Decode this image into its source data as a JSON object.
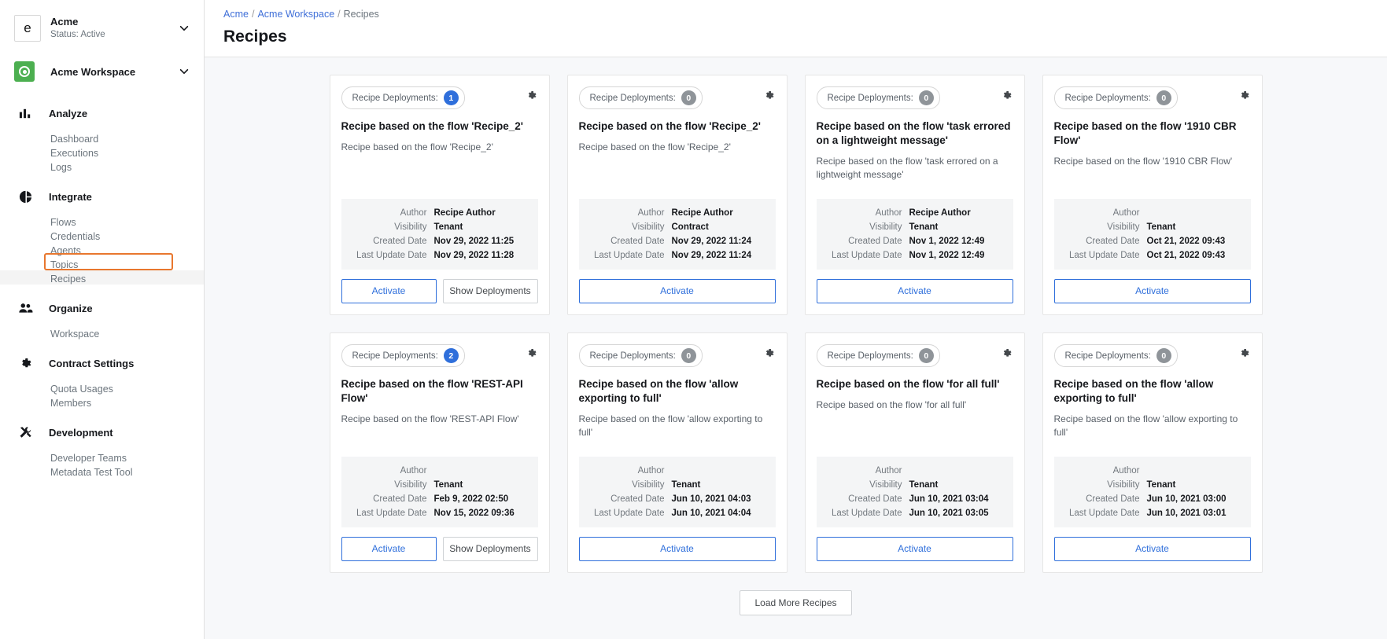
{
  "sidebar": {
    "org": {
      "initial": "e",
      "name": "Acme",
      "status": "Status: Active"
    },
    "workspace": {
      "name": "Acme Workspace"
    },
    "groups": [
      {
        "label": "Analyze",
        "icon": "bar-chart-icon",
        "items": [
          {
            "label": "Dashboard"
          },
          {
            "label": "Executions"
          },
          {
            "label": "Logs"
          }
        ]
      },
      {
        "label": "Integrate",
        "icon": "pie-chart-icon",
        "items": [
          {
            "label": "Flows"
          },
          {
            "label": "Credentials"
          },
          {
            "label": "Agents"
          },
          {
            "label": "Topics"
          },
          {
            "label": "Recipes",
            "active": true
          }
        ]
      },
      {
        "label": "Organize",
        "icon": "people-icon",
        "items": [
          {
            "label": "Workspace"
          }
        ]
      },
      {
        "label": "Contract Settings",
        "icon": "gear-icon",
        "items": [
          {
            "label": "Quota Usages"
          },
          {
            "label": "Members"
          }
        ]
      },
      {
        "label": "Development",
        "icon": "tools-icon",
        "items": [
          {
            "label": "Developer Teams"
          },
          {
            "label": "Metadata Test Tool"
          }
        ]
      }
    ]
  },
  "header": {
    "breadcrumb": [
      {
        "label": "Acme",
        "link": true
      },
      {
        "label": "Acme Workspace",
        "link": true
      },
      {
        "label": "Recipes",
        "link": false
      }
    ],
    "title": "Recipes"
  },
  "labels": {
    "deployments_prefix": "Recipe Deployments:",
    "author": "Author",
    "visibility": "Visibility",
    "created_date": "Created Date",
    "last_update_date": "Last Update Date",
    "activate": "Activate",
    "show_deployments": "Show Deployments",
    "load_more": "Load More Recipes"
  },
  "colors": {
    "accent_blue": "#2f6fdb",
    "badge_zero": "#8f9499",
    "annotation": "#e8772e",
    "workspace_green": "#4caf50"
  },
  "cards": [
    {
      "deployments": "1",
      "title": "Recipe based on the flow 'Recipe_2'",
      "description": "Recipe based on the flow 'Recipe_2'",
      "author": "Recipe Author",
      "visibility": "Tenant",
      "created_date": "Nov 29, 2022 11:25",
      "last_update_date": "Nov 29, 2022 11:28",
      "has_show_deployments": true
    },
    {
      "deployments": "0",
      "title": "Recipe based on the flow 'Recipe_2'",
      "description": "Recipe based on the flow 'Recipe_2'",
      "author": "Recipe Author",
      "visibility": "Contract",
      "created_date": "Nov 29, 2022 11:24",
      "last_update_date": "Nov 29, 2022 11:24",
      "has_show_deployments": false
    },
    {
      "deployments": "0",
      "title": "Recipe based on the flow 'task errored on a lightweight message'",
      "description": "Recipe based on the flow 'task errored on a lightweight message'",
      "author": "Recipe Author",
      "visibility": "Tenant",
      "created_date": "Nov 1, 2022 12:49",
      "last_update_date": "Nov 1, 2022 12:49",
      "has_show_deployments": false
    },
    {
      "deployments": "0",
      "title": "Recipe based on the flow '1910 CBR Flow'",
      "description": "Recipe based on the flow '1910 CBR Flow'",
      "author": "",
      "visibility": "Tenant",
      "created_date": "Oct 21, 2022 09:43",
      "last_update_date": "Oct 21, 2022 09:43",
      "has_show_deployments": false
    },
    {
      "deployments": "2",
      "title": "Recipe based on the flow 'REST-API Flow'",
      "description": "Recipe based on the flow 'REST-API Flow'",
      "author": "",
      "visibility": "Tenant",
      "created_date": "Feb 9, 2022 02:50",
      "last_update_date": "Nov 15, 2022 09:36",
      "has_show_deployments": true
    },
    {
      "deployments": "0",
      "title": "Recipe based on the flow 'allow exporting to full'",
      "description": "Recipe based on the flow 'allow exporting to full'",
      "author": "",
      "visibility": "Tenant",
      "created_date": "Jun 10, 2021 04:03",
      "last_update_date": "Jun 10, 2021 04:04",
      "has_show_deployments": false
    },
    {
      "deployments": "0",
      "title": "Recipe based on the flow 'for all full'",
      "description": "Recipe based on the flow 'for all full'",
      "author": "",
      "visibility": "Tenant",
      "created_date": "Jun 10, 2021 03:04",
      "last_update_date": "Jun 10, 2021 03:05",
      "has_show_deployments": false
    },
    {
      "deployments": "0",
      "title": "Recipe based on the flow 'allow exporting to full'",
      "description": "Recipe based on the flow 'allow exporting to full'",
      "author": "",
      "visibility": "Tenant",
      "created_date": "Jun 10, 2021 03:00",
      "last_update_date": "Jun 10, 2021 03:01",
      "has_show_deployments": false
    }
  ]
}
